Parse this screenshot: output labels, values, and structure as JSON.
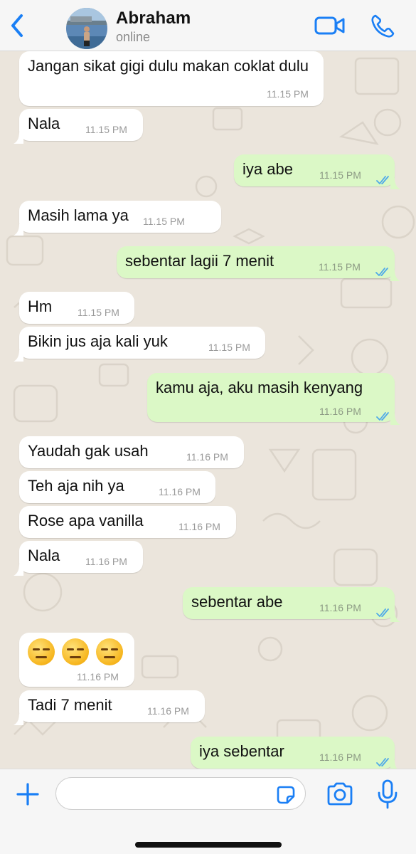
{
  "header": {
    "contact_name": "Abraham",
    "status": "online"
  },
  "messages": [
    {
      "dir": "in",
      "text": "Jangan sikat gigi dulu makan coklat dulu",
      "time": "11.15 PM"
    },
    {
      "dir": "in",
      "text": "Nala",
      "time": "11.15 PM"
    },
    {
      "dir": "out",
      "text": "iya abe",
      "time": "11.15 PM",
      "status": "read"
    },
    {
      "dir": "in",
      "text": "Masih lama ya",
      "time": "11.15 PM"
    },
    {
      "dir": "out",
      "text": "sebentar lagii 7 menit",
      "time": "11.15 PM",
      "status": "read"
    },
    {
      "dir": "in",
      "text": "Hm",
      "time": "11.15 PM"
    },
    {
      "dir": "in",
      "text": "Bikin jus aja kali yuk",
      "time": "11.15 PM"
    },
    {
      "dir": "out",
      "text": "kamu aja, aku masih kenyang",
      "time": "11.16 PM",
      "status": "read"
    },
    {
      "dir": "in",
      "text": "Yaudah gak usah",
      "time": "11.16 PM"
    },
    {
      "dir": "in",
      "text": "Teh aja nih ya",
      "time": "11.16 PM"
    },
    {
      "dir": "in",
      "text": "Rose apa vanilla",
      "time": "11.16 PM"
    },
    {
      "dir": "in",
      "text": "Nala",
      "time": "11.16 PM"
    },
    {
      "dir": "out",
      "text": "sebentar abe",
      "time": "11.16 PM",
      "status": "read"
    },
    {
      "dir": "in",
      "text": "😑😑😑",
      "time": "11.16 PM",
      "emoji": "expressionless-face"
    },
    {
      "dir": "in",
      "text": "Tadi 7 menit",
      "time": "11.16 PM"
    },
    {
      "dir": "out",
      "text": "iya sebentar",
      "time": "11.16 PM",
      "status": "read"
    }
  ],
  "composer": {
    "placeholder": ""
  },
  "icons": {
    "back": "chevron-left-icon",
    "video": "video-camera-icon",
    "call": "phone-icon",
    "plus": "plus-icon",
    "sticker": "sticker-icon",
    "camera": "camera-icon",
    "mic": "microphone-icon"
  },
  "colors": {
    "accent": "#1a7ff5",
    "incoming_bubble": "#ffffff",
    "outgoing_bubble": "#dbf8c6",
    "read_ticks": "#4fa9e8",
    "wallpaper": "#ebe5dc"
  }
}
